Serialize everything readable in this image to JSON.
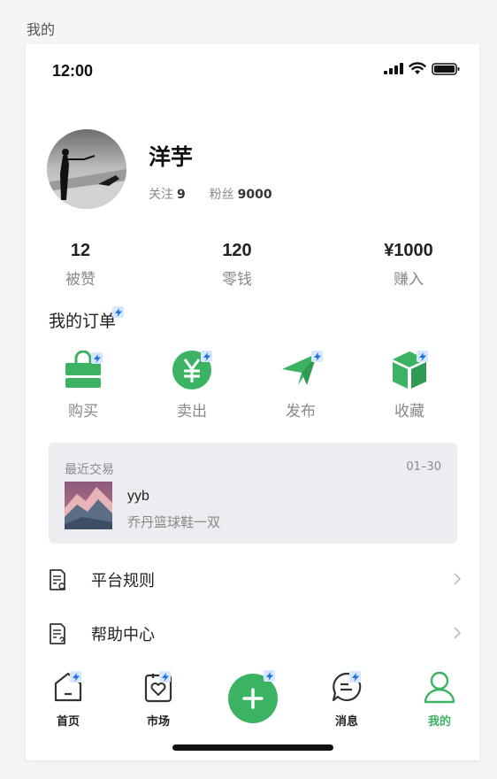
{
  "frame_label": "我的",
  "status_bar": {
    "time": "12:00"
  },
  "profile": {
    "name": "洋芋",
    "following_label": "关注",
    "following_count": "9",
    "fans_label": "粉丝",
    "fans_count": "9000"
  },
  "stats": [
    {
      "value": "12",
      "label": "被赞"
    },
    {
      "value": "120",
      "label": "零钱"
    },
    {
      "value": "¥1000",
      "label": "赚入"
    }
  ],
  "orders": {
    "title": "我的订单",
    "items": [
      {
        "label": "购买",
        "icon": "shopping-bag-icon"
      },
      {
        "label": "卖出",
        "icon": "yuan-coin-icon"
      },
      {
        "label": "发布",
        "icon": "paper-plane-icon"
      },
      {
        "label": "收藏",
        "icon": "box-icon"
      }
    ]
  },
  "recent_trade": {
    "title": "最近交易",
    "date": "01–30",
    "user": "yyb",
    "item": "乔丹篮球鞋一双"
  },
  "menu": [
    {
      "label": "平台规则",
      "icon": "document-rules-icon"
    },
    {
      "label": "帮助中心",
      "icon": "document-help-icon"
    }
  ],
  "tabbar": {
    "items": [
      {
        "label": "首页",
        "icon": "home-icon"
      },
      {
        "label": "市场",
        "icon": "market-bag-icon"
      },
      {
        "label": "消息",
        "icon": "message-icon"
      },
      {
        "label": "我的",
        "icon": "user-icon"
      }
    ],
    "active": "我的"
  },
  "colors": {
    "accent": "#3cb263",
    "badge": "#d6e8ff"
  }
}
